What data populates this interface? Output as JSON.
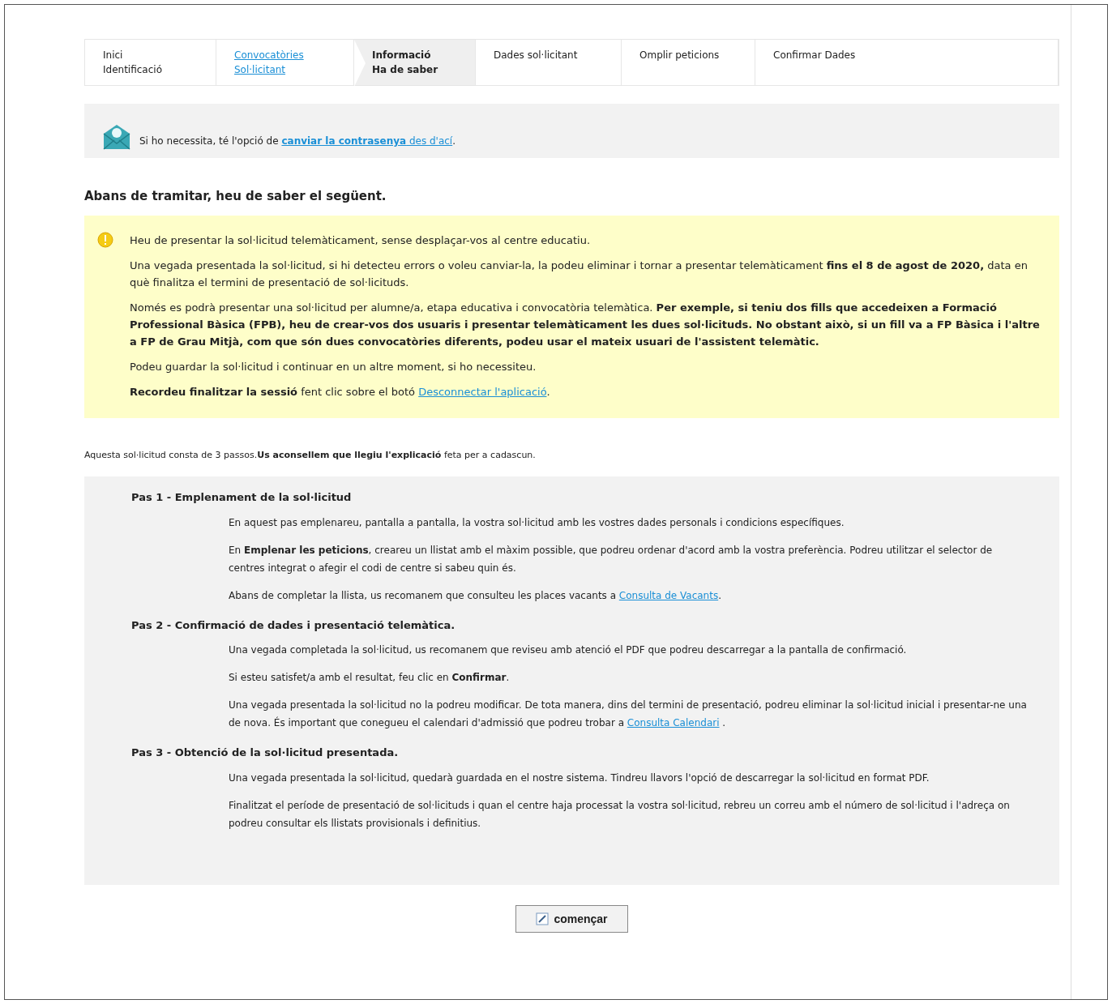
{
  "steps": [
    {
      "lines": [
        "Inici",
        "Identificació"
      ],
      "kind": "pending",
      "selected": false
    },
    {
      "lines": [
        "Convocatòries",
        "Sol·licitant"
      ],
      "kind": "done",
      "selected": false
    },
    {
      "lines": [
        "Informació",
        "Ha de saber"
      ],
      "kind": "current",
      "selected": true
    },
    {
      "lines": [
        "Dades sol·licitant"
      ],
      "kind": "pending",
      "selected": false
    },
    {
      "lines": [
        "Omplir peticions"
      ],
      "kind": "pending",
      "selected": false
    },
    {
      "lines": [
        "Confirmar Dades"
      ],
      "kind": "pending",
      "selected": false
    }
  ],
  "password_notice": [
    {
      "kind": "text",
      "text": "Si ho necessita, té l'opció de "
    },
    {
      "kind": "link_bold",
      "text": "canviar la contrasenya"
    },
    {
      "kind": "link",
      "text": " des d'ací"
    },
    {
      "kind": "text",
      "text": "."
    }
  ],
  "heading": "Abans de tramitar, heu de saber el següent.",
  "warning_paragraphs": [
    [
      {
        "kind": "text",
        "text": "Heu de presentar la sol·licitud telemàticament, sense desplaçar-vos al centre educatiu."
      }
    ],
    [
      {
        "kind": "text",
        "text": "Una vegada presentada la sol·licitud, si hi detecteu errors o voleu canviar-la, la podeu eliminar i tornar a presentar telemàticament **fins el 8 de agost de 2020,** data en què finalitza el termini de presentació de sol·licituds."
      }
    ],
    [
      {
        "kind": "text",
        "text": "Només es podrà presentar una sol·licitud per alumne/a, etapa educativa i convocatòria telemàtica. **Per exemple, si teniu dos fills que accedeixen a Formació Professional Bàsica (FPB), heu de crear-vos dos usuaris i presentar telemàticament les dues sol·licituds. No obstant això, si un fill va a FP Bàsica i l'altre a FP de Grau Mitjà, com que són dues convocatòries diferents, podeu usar el mateix usuari de l'assistent telemàtic.**"
      }
    ],
    [
      {
        "kind": "text",
        "text": "Podeu guardar la sol·licitud i continuar en un altre moment, si ho necessiteu."
      }
    ],
    [
      {
        "kind": "text",
        "text": "**Recordeu finalitzar la sessió** fent clic sobre el botó "
      },
      {
        "kind": "link",
        "text": "Desconnectar l'aplicació"
      },
      {
        "kind": "text",
        "text": "."
      }
    ]
  ],
  "intro": [
    {
      "kind": "text",
      "text": "Aquesta sol·licitud consta de 3 passos.**Us aconsellem que llegiu l'explicació** feta per a cadascun."
    }
  ],
  "passos": [
    {
      "title": "Pas 1 - Emplenament de la sol·licitud",
      "paragraphs": [
        [
          {
            "kind": "text",
            "text": "En aquest pas emplenareu, pantalla a pantalla, la vostra sol·licitud amb les vostres dades personals i condicions específiques."
          }
        ],
        [
          {
            "kind": "text",
            "text": "En **Emplenar les peticions**, creareu un llistat amb el màxim possible, que podreu ordenar d'acord amb la vostra preferència. Podreu utilitzar el selector de centres integrat o afegir el codi de centre si sabeu quin és."
          }
        ],
        [
          {
            "kind": "text",
            "text": "Abans de completar la llista, us recomanem que consulteu les places vacants a "
          },
          {
            "kind": "link",
            "text": "Consulta de Vacants"
          },
          {
            "kind": "text",
            "text": "."
          }
        ]
      ]
    },
    {
      "title": "Pas 2 - Confirmació de dades i presentació telemàtica.",
      "paragraphs": [
        [
          {
            "kind": "text",
            "text": "Una vegada completada la sol·licitud, us recomanem que reviseu amb atenció el PDF que podreu descarregar a la pantalla de confirmació."
          }
        ],
        [
          {
            "kind": "text",
            "text": "Si esteu satisfet/a amb el resultat, feu clic en **Confirmar**."
          }
        ],
        [
          {
            "kind": "text",
            "text": "Una vegada presentada la sol·licitud no la podreu modificar. De tota manera, dins del termini de presentació, podreu eliminar la sol·licitud inicial i presentar-ne una de nova. És important que conegueu el calendari d'admissió que podreu trobar a "
          },
          {
            "kind": "link",
            "text": "Consulta Calendari"
          },
          {
            "kind": "text",
            "text": " ."
          }
        ]
      ]
    },
    {
      "title": "Pas 3 - Obtenció de la sol·licitud presentada.",
      "paragraphs": [
        [
          {
            "kind": "text",
            "text": "Una vegada presentada la sol·licitud, quedarà guardada en el nostre sistema. Tindreu llavors l'opció de descarregar la sol·licitud en format PDF."
          }
        ],
        [
          {
            "kind": "text",
            "text": "Finalitzat el període de presentació de sol·licituds i quan el centre haja processat la vostra sol·licitud, rebreu un correu amb el número de sol·licitud i l'adreça on podreu consultar els llistats provisionals i definitius."
          }
        ]
      ]
    }
  ],
  "start_button": "començar"
}
